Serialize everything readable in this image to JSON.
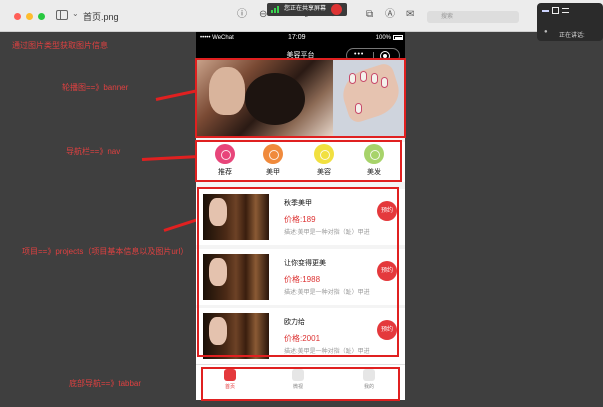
{
  "window": {
    "file_title": "首页.png",
    "screen_share_text": "您正在共享屏幕",
    "search_placeholder": "搜索",
    "voice_text": "正在讲话:"
  },
  "annotations": {
    "header_note": "通过图片类型获取图片信息",
    "banner": "轮播图==》banner",
    "nav": "导航栏==》nav",
    "projects": "项目==》projects（项目基本信息以及图片url）",
    "tabbar": "底部导航==》tabbar"
  },
  "phone": {
    "carrier": "••••• WeChat",
    "time": "17:09",
    "battery": "100%",
    "page_title": "美容平台",
    "capsule_more": "•••"
  },
  "nav_items": [
    {
      "label": "推荐",
      "color": "#e8457a"
    },
    {
      "label": "美甲",
      "color": "#f08a3c"
    },
    {
      "label": "美容",
      "color": "#f1e040"
    },
    {
      "label": "美发",
      "color": "#a7d36a"
    }
  ],
  "projects": [
    {
      "name": "秋季美甲",
      "price": "价格:189",
      "desc": "描述:美甲是一种对指（趾）甲进",
      "book": "预约"
    },
    {
      "name": "让你变得更美",
      "price": "价格:1988",
      "desc": "描述:美甲是一种对指（趾）甲进",
      "book": "预约"
    },
    {
      "name": "欧力给",
      "price": "价格:2001",
      "desc": "描述:美甲是一种对指（趾）甲进",
      "book": "预约"
    }
  ],
  "tabbar": {
    "items": [
      {
        "label": "首页",
        "icon": "home-icon",
        "active": true
      },
      {
        "label": "微视",
        "icon": "user-icon",
        "active": false
      },
      {
        "label": "我的",
        "icon": "profile-icon",
        "active": false
      }
    ]
  },
  "colors": {
    "accent_red": "#e4393c",
    "annotation_red": "#e02020"
  }
}
